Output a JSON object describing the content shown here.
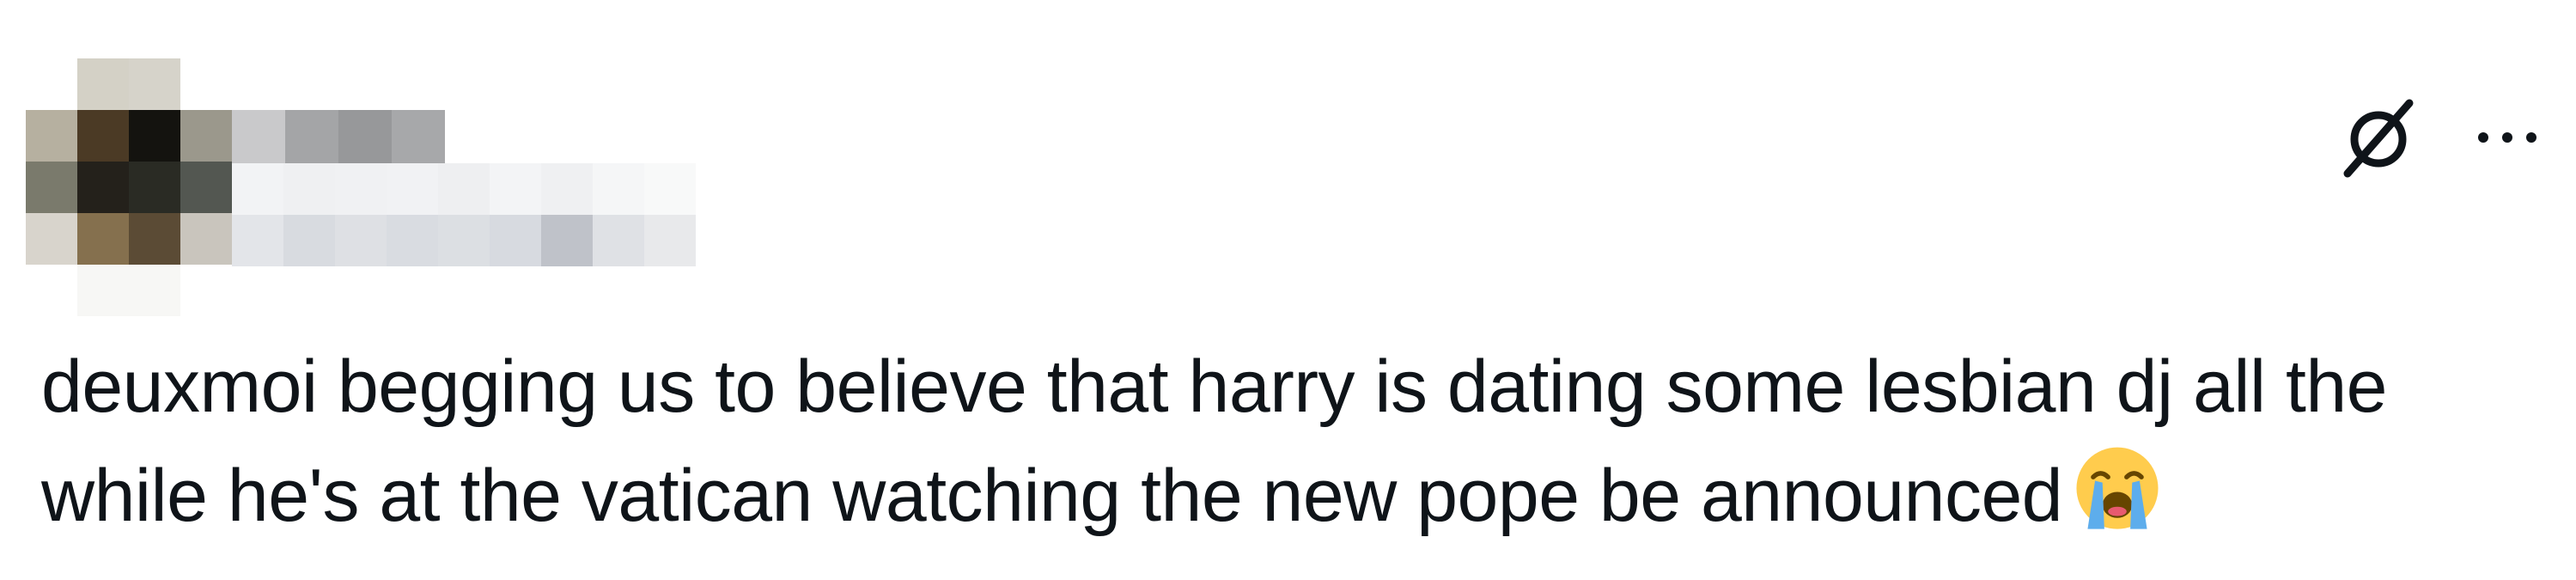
{
  "tweet": {
    "text_line_1": "deuxmoi begging us to believe that harry is dating some lesbian dj all the",
    "text_line_2": "while he's at the vatican watching the new pope be announced",
    "emoji": "loudly-crying-face"
  },
  "header": {
    "grok_icon": "grok-icon",
    "more_icon": "more-horizontal-icon"
  },
  "colors": {
    "text": "#0f1419",
    "icon": "#0f1419",
    "background": "#ffffff"
  }
}
